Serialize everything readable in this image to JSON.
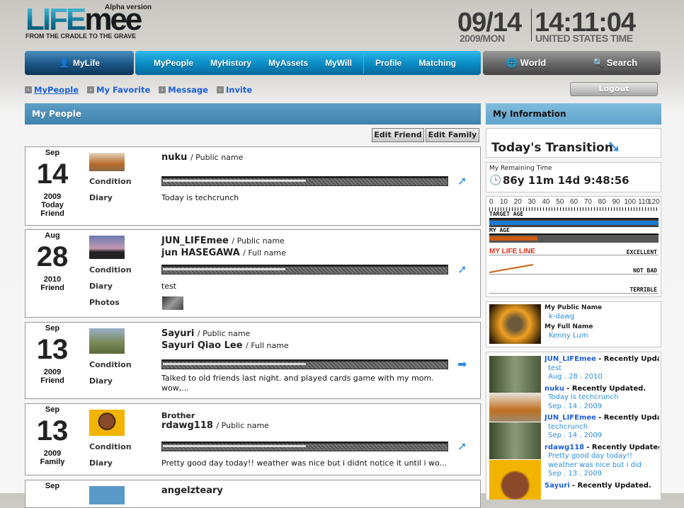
{
  "header": {
    "logo_text": "LIFEmee",
    "logo_alpha": "Alpha version",
    "tagline": "FROM THE CRADLE TO THE GRAVE",
    "date": "09/14",
    "date_sub": "2009/MON",
    "time": "14:11:04",
    "time_sub": "UNITED STATES TIME"
  },
  "nav": {
    "mylife": "MyLife",
    "items": [
      "MyPeople",
      "MyHistory",
      "MyAssets",
      "MyWill"
    ],
    "items2": [
      "Profile",
      "Matching"
    ],
    "world": "World",
    "search": "Search"
  },
  "subnav": {
    "items": [
      "MyPeople",
      "My Favorite",
      "Message",
      "Invite"
    ],
    "logout": "Logout"
  },
  "main": {
    "title": "My People",
    "edit_friend": "Edit Friend",
    "edit_family": "Edit Family",
    "labels": {
      "condition": "Condition",
      "diary": "Diary",
      "photos": "Photos",
      "public": "/ Public name",
      "full": "/ Full name"
    },
    "people": [
      {
        "month": "Sep",
        "day": "14",
        "year": "2009",
        "extra": "Today",
        "relation": "Friend",
        "public_name": "nuku",
        "diary": "Today is techcrunch",
        "condition": 0.5
      },
      {
        "month": "Aug",
        "day": "28",
        "year": "2010",
        "relation": "Friend",
        "public_name": "JUN_LIFEmee",
        "full_name": "jun  HASEGAWA",
        "diary": "test",
        "condition": 0.43
      },
      {
        "month": "Sep",
        "day": "13",
        "year": "2009",
        "relation": "Friend",
        "public_name": "Sayuri",
        "full_name": "Sayuri Qiao Lee",
        "diary": "Talked to old friends last night. and played cards game with my mom. wow,...",
        "condition": 0.5
      },
      {
        "month": "Sep",
        "day": "13",
        "year": "2009",
        "relation": "Family",
        "role": "Brother",
        "public_name": "rdawg118",
        "diary": "Pretty good day today!! weather was nice but i didnt notice it until i wo...",
        "condition": 0.5
      },
      {
        "month": "Sep",
        "public_name": "angelzteary"
      }
    ]
  },
  "side": {
    "title": "My Information",
    "transition": "Today's Transition",
    "remaining_label": "My Remaining Time",
    "remaining": "86y 11m 14d 9:48:56",
    "ticks": [
      "0",
      "10",
      "20",
      "30",
      "40",
      "50",
      "60",
      "70",
      "80",
      "90",
      "100",
      "110",
      "120"
    ],
    "target_age_label": "TARGET AGE",
    "my_age_label": "MY AGE",
    "target_age": 120,
    "my_age": 34,
    "lifeline_label": "MY LIFE LINE",
    "excellent": "EXCELLENT",
    "not_bad": "NOT BAD",
    "terrible": "TERRIBLE",
    "public_name_label": "My Public Name",
    "public_name": "k-dawg",
    "full_name_label": "My Full Name",
    "full_name": "Kenny Lum",
    "updates": [
      {
        "who": "JUN_LIFEmee",
        "what": "- Recently Updated.",
        "text": "test",
        "date": "Aug . 28 . 2010"
      },
      {
        "who": "nuku",
        "what": "- Recently Updated.",
        "text": "Today is techcrunch",
        "date": "Sep . 14 . 2009"
      },
      {
        "who": "JUN_LIFEmee",
        "what": "- Recently Updated.",
        "text": "techcrunch",
        "date": "Sep . 14 . 2009"
      },
      {
        "who": "rdawg118",
        "what": "- Recently Updated.",
        "text": "Pretty good day today!!",
        "text2": "weather was nice but i did",
        "date": "Sep . 13 . 2009"
      },
      {
        "who": "Sayuri",
        "what": "- Recently Updated."
      }
    ]
  },
  "colors": {
    "nav_blue": "#0a8fc7",
    "header_blue": "#4e90b8",
    "link": "#1d5fd6",
    "accent_orange": "#e0601a"
  }
}
